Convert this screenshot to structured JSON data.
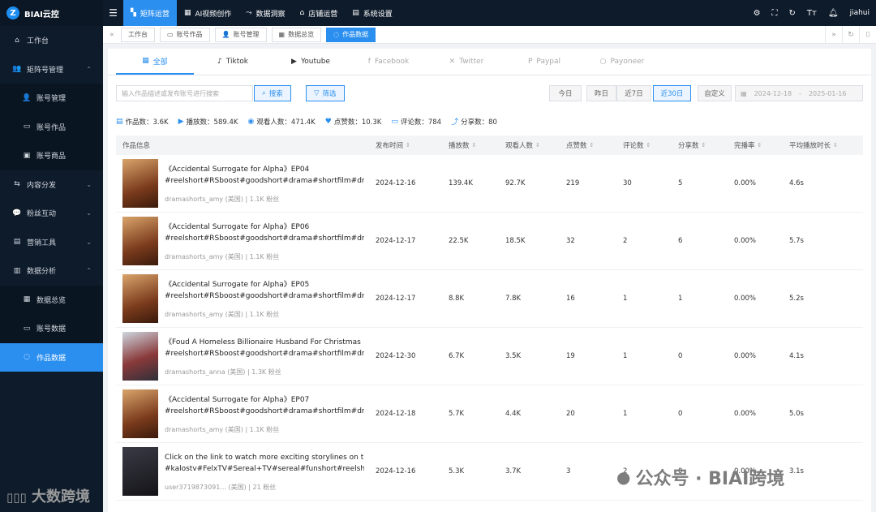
{
  "app": {
    "logo_letter": "Z",
    "name": "BIAI云控"
  },
  "sidebar": {
    "items": [
      {
        "icon": "home-icon",
        "glyph": "⌂",
        "label": "工作台",
        "level": 0
      },
      {
        "icon": "group-icon",
        "glyph": "👥",
        "label": "矩阵号管理",
        "level": 0,
        "chevron": "⌃"
      },
      {
        "icon": "user-icon",
        "glyph": "👤",
        "label": "账号管理",
        "level": 1
      },
      {
        "icon": "video-icon",
        "glyph": "▭",
        "label": "账号作品",
        "level": 1
      },
      {
        "icon": "goods-icon",
        "glyph": "▣",
        "label": "账号商品",
        "level": 1
      },
      {
        "icon": "distribute-icon",
        "glyph": "⇆",
        "label": "内容分发",
        "level": 0,
        "chevron": "⌄"
      },
      {
        "icon": "chat-icon",
        "glyph": "💬",
        "label": "粉丝互动",
        "level": 0,
        "chevron": "⌄"
      },
      {
        "icon": "marketing-icon",
        "glyph": "▤",
        "label": "营销工具",
        "level": 0,
        "chevron": "⌄"
      },
      {
        "icon": "chart-icon",
        "glyph": "▥",
        "label": "数据分析",
        "level": 0,
        "chevron": "⌃"
      },
      {
        "icon": "overview-icon",
        "glyph": "▦",
        "label": "数据总览",
        "level": 1
      },
      {
        "icon": "account-data-icon",
        "glyph": "▭",
        "label": "账号数据",
        "level": 1
      },
      {
        "icon": "works-data-icon",
        "glyph": "◌",
        "label": "作品数据",
        "level": 1,
        "active": true
      }
    ]
  },
  "topnav": {
    "items": [
      {
        "icon": "matrix-icon",
        "glyph": "▚",
        "label": "矩阵运营",
        "active": true
      },
      {
        "icon": "ai-video-icon",
        "glyph": "▦",
        "label": "AI视频创作"
      },
      {
        "icon": "insight-icon",
        "glyph": "⤳",
        "label": "数据洞察"
      },
      {
        "icon": "shop-icon",
        "glyph": "⌂",
        "label": "店铺运营"
      },
      {
        "icon": "settings-doc-icon",
        "glyph": "▤",
        "label": "系统设置"
      }
    ],
    "user": "jiahui"
  },
  "tabs": {
    "items": [
      {
        "icon": "",
        "label": "工作台"
      },
      {
        "icon": "video-icon",
        "glyph": "▭",
        "label": "账号作品"
      },
      {
        "icon": "user-icon",
        "glyph": "👤",
        "label": "账号管理"
      },
      {
        "icon": "overview-icon",
        "glyph": "▦",
        "label": "数据总览"
      },
      {
        "icon": "works-data-icon",
        "glyph": "◌",
        "label": "作品数据",
        "active": true
      }
    ]
  },
  "platforms": [
    {
      "icon": "grid-icon",
      "glyph": "▦",
      "label": "全部",
      "active": true
    },
    {
      "icon": "tiktok-icon",
      "glyph": "♪",
      "label": "Tiktok"
    },
    {
      "icon": "youtube-icon",
      "glyph": "▶",
      "label": "Youtube"
    },
    {
      "icon": "facebook-icon",
      "glyph": "f",
      "label": "Facebook",
      "dim": true
    },
    {
      "icon": "x-icon",
      "glyph": "✕",
      "label": "Twitter",
      "dim": true
    },
    {
      "icon": "paypal-icon",
      "glyph": "P",
      "label": "Paypal",
      "dim": true
    },
    {
      "icon": "payoneer-icon",
      "glyph": "○",
      "label": "Payoneer",
      "dim": true
    }
  ],
  "filters": {
    "search_placeholder": "输入作品描述或发布账号进行搜索",
    "search_btn": "搜索",
    "filter_btn": "筛选",
    "date_buttons": [
      {
        "label": "今日"
      },
      {
        "label": "昨日"
      },
      {
        "label": "近7日"
      },
      {
        "label": "近30日",
        "active": true
      },
      {
        "label": "自定义"
      }
    ],
    "date_start": "2024-12-18",
    "date_sep": "-",
    "date_end": "2025-01-16"
  },
  "stats": [
    {
      "icon": "doc-icon",
      "glyph": "▤",
      "label": "作品数：3.6K"
    },
    {
      "icon": "play-icon",
      "glyph": "▶",
      "label": "播放数：589.4K"
    },
    {
      "icon": "eye-icon",
      "glyph": "◉",
      "label": "观看人数：471.4K"
    },
    {
      "icon": "like-icon",
      "glyph": "♥",
      "label": "点赞数：10.3K"
    },
    {
      "icon": "comment-icon",
      "glyph": "▭",
      "label": "评论数：784"
    },
    {
      "icon": "share-icon",
      "glyph": "⤴",
      "label": "分享数：80"
    }
  ],
  "table": {
    "headers": [
      "作品信息",
      "发布时间",
      "播放数",
      "观看人数",
      "点赞数",
      "评论数",
      "分享数",
      "完播率",
      "平均播放时长"
    ],
    "rows": [
      {
        "thumb": "",
        "title1": "《Accidental Surrogate for Alpha》EP04",
        "title2": "#reelshort#RSboost#goodshort#drama#shortfilm#drama",
        "meta": "dramashorts_amy (美国) | 1.1K 粉丝",
        "date": "2024-12-16",
        "plays": "139.4K",
        "viewers": "92.7K",
        "likes": "219",
        "comments": "30",
        "shares": "5",
        "completion": "0.00%",
        "avg": "4.6s"
      },
      {
        "thumb": "",
        "title1": "《Accidental Surrogate for Alpha》EP06",
        "title2": "#reelshort#RSboost#goodshort#drama#shortfilm#drama",
        "meta": "dramashorts_amy (美国) | 1.1K 粉丝",
        "date": "2024-12-17",
        "plays": "22.5K",
        "viewers": "18.5K",
        "likes": "32",
        "comments": "2",
        "shares": "6",
        "completion": "0.00%",
        "avg": "5.7s"
      },
      {
        "thumb": "",
        "title1": "《Accidental Surrogate for Alpha》EP05",
        "title2": "#reelshort#RSboost#goodshort#drama#shortfilm#drama",
        "meta": "dramashorts_amy (美国) | 1.1K 粉丝",
        "date": "2024-12-17",
        "plays": "8.8K",
        "viewers": "7.8K",
        "likes": "16",
        "comments": "1",
        "shares": "1",
        "completion": "0.00%",
        "avg": "5.2s"
      },
      {
        "thumb": "alt",
        "title1": "《Foud A Homeless Billionaire Husband For Christmas",
        "title2": "#reelshort#RSboost#goodshort#drama#shortfilm#drama",
        "meta": "dramashorts_anna (美国) | 1.3K 粉丝",
        "date": "2024-12-30",
        "plays": "6.7K",
        "viewers": "3.5K",
        "likes": "19",
        "comments": "1",
        "shares": "0",
        "completion": "0.00%",
        "avg": "4.1s"
      },
      {
        "thumb": "",
        "title1": "《Accidental Surrogate for Alpha》EP07",
        "title2": "#reelshort#RSboost#goodshort#drama#shortfilm#drama",
        "meta": "dramashorts_amy (美国) | 1.1K 粉丝",
        "date": "2024-12-18",
        "plays": "5.7K",
        "viewers": "4.4K",
        "likes": "20",
        "comments": "1",
        "shares": "0",
        "completion": "0.00%",
        "avg": "5.0s"
      },
      {
        "thumb": "dark",
        "title1": "Click on the link to watch more exciting storylines on t",
        "title2": "#kalostv#FelxTV#Sereal+TV#sereal#funshort#reelshor",
        "meta": "user3719873091... (美国) | 21 粉丝",
        "date": "2024-12-16",
        "plays": "5.3K",
        "viewers": "3.7K",
        "likes": "3",
        "comments": "2",
        "shares": "0",
        "completion": "0.00%",
        "avg": "3.1s"
      }
    ]
  },
  "watermarks": {
    "left": "大数跨境",
    "right": "公众号 · BIAI跨境"
  },
  "colors": {
    "accent": "#2b8ff0",
    "sidebar_bg": "#0e1b2b"
  }
}
